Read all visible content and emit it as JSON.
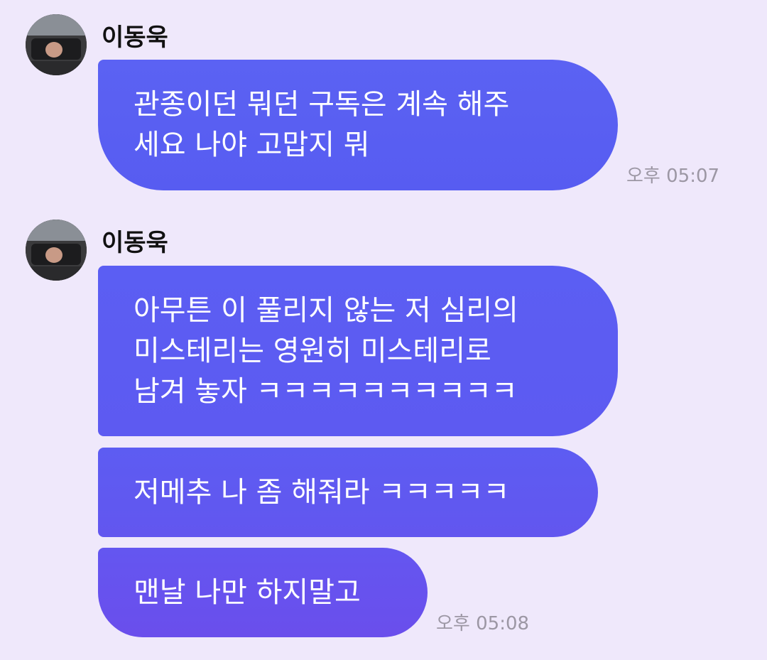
{
  "messages": [
    {
      "sender": "이동욱",
      "avatar_icon": "profile-photo",
      "bubbles": [
        {
          "lines": [
            "관종이던 뭐던 구독은 계속 해주",
            "세요 나야 고맙지 뭐"
          ]
        }
      ],
      "time": "오후 05:07"
    },
    {
      "sender": "이동욱",
      "avatar_icon": "profile-photo",
      "bubbles": [
        {
          "lines": [
            "아무튼 이 풀리지 않는 저 심리의",
            "미스테리는 영원히 미스테리로",
            "남겨 놓자 ㅋㅋㅋㅋㅋㅋㅋㅋㅋㅋ"
          ]
        },
        {
          "lines": [
            "저메추 나 좀 해줘라 ㅋㅋㅋㅋㅋ"
          ]
        },
        {
          "lines": [
            "맨날 나만 하지말고"
          ]
        }
      ],
      "time": "오후 05:08"
    }
  ],
  "colors": {
    "background": "#efe8fb",
    "bubble": "#5b5ef3",
    "bubble_text": "#ffffff",
    "timestamp": "#9c97a4"
  }
}
